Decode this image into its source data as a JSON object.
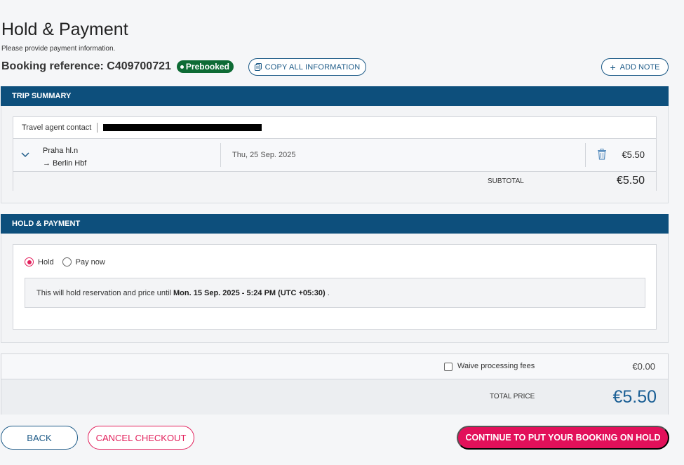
{
  "header": {
    "title": "Hold & Payment",
    "subtitle": "Please provide payment information.",
    "booking_reference": "Booking reference: C409700721",
    "status_badge": "Prebooked",
    "copy_all_label": "COPY ALL INFORMATION",
    "add_note_label": "ADD NOTE"
  },
  "trip_summary": {
    "heading": "TRIP SUMMARY",
    "agent_contact_label": "Travel agent contact",
    "trips": [
      {
        "from": "Praha hl.n",
        "to": "→ Berlin Hbf",
        "date": "Thu, 25 Sep. 2025",
        "price": "€5.50"
      }
    ],
    "subtotal_label": "SUBTOTAL",
    "subtotal_value": "€5.50"
  },
  "hold_payment": {
    "heading": "HOLD & PAYMENT",
    "options": [
      {
        "label": "Hold",
        "selected": true
      },
      {
        "label": "Pay now",
        "selected": false
      }
    ],
    "info_prefix": "This will hold reservation and price until",
    "info_datetime": "Mon. 15 Sep. 2025 - 5:24 PM (UTC +05:30)",
    "info_suffix": "."
  },
  "totals": {
    "waive_label": "Waive processing fees",
    "waive_checked": false,
    "fees_value": "€0.00",
    "total_label": "TOTAL PRICE",
    "total_value": "€5.50"
  },
  "actions": {
    "back_label": "BACK",
    "cancel_label": "CANCEL CHECKOUT",
    "continue_label": "CONTINUE TO PUT YOUR BOOKING ON HOLD"
  },
  "colors": {
    "primary": "#0d4f7c",
    "accent": "#e2105a",
    "badge": "#0e6b35",
    "total": "#1b5f95"
  }
}
